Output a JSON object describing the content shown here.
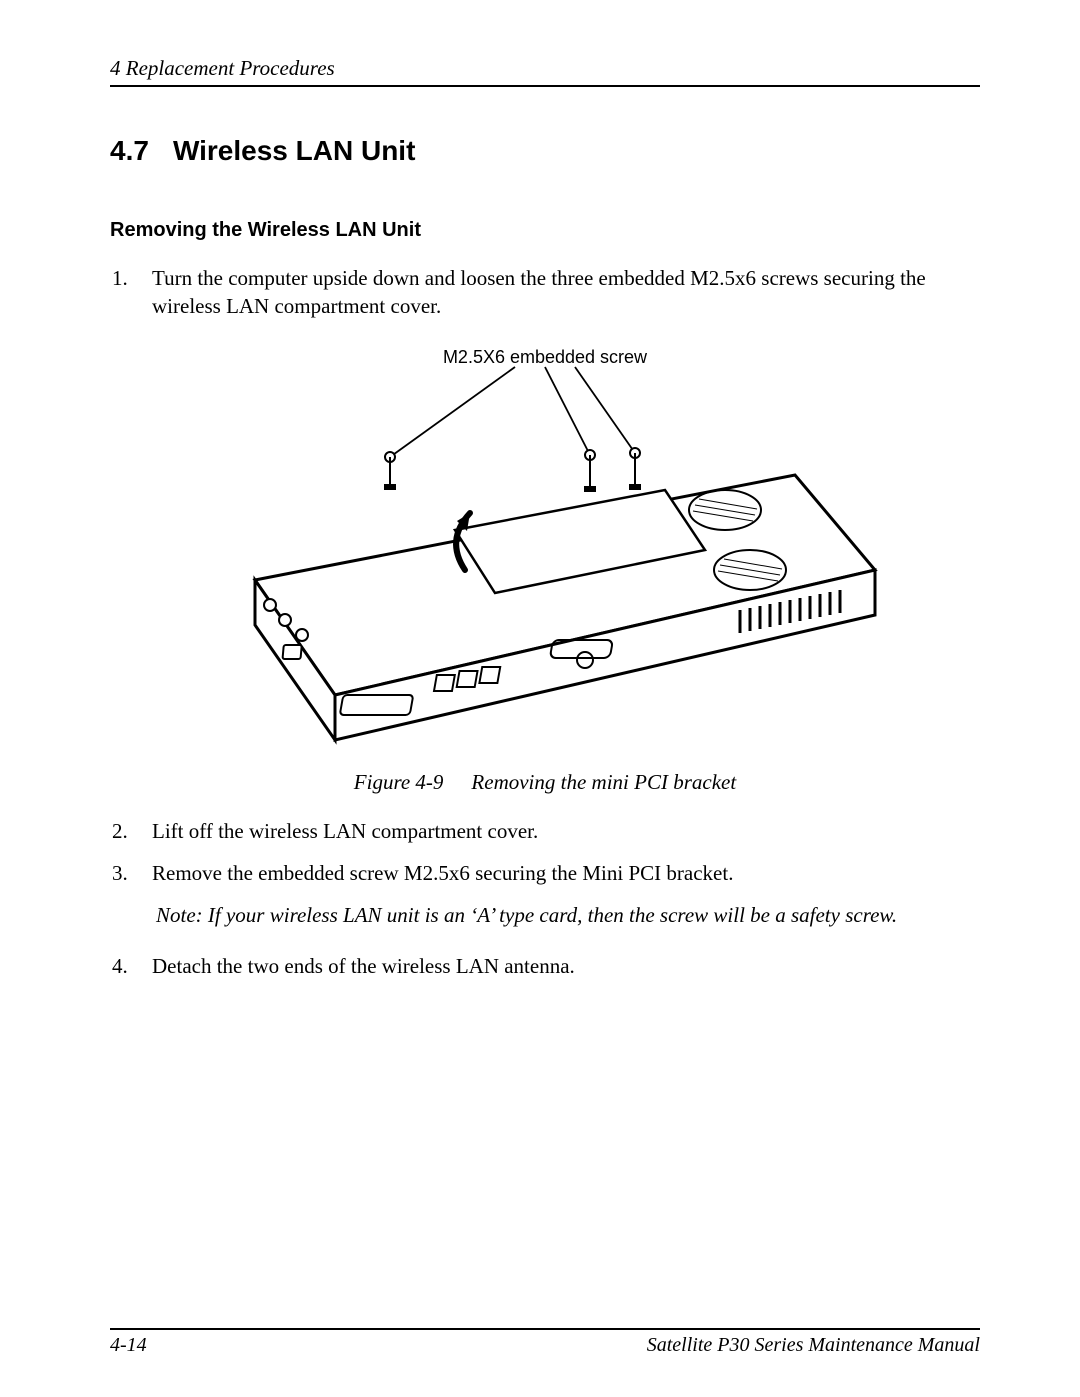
{
  "header": {
    "chapter_line": "4  Replacement Procedures"
  },
  "section": {
    "number": "4.7",
    "title": "Wireless LAN Unit"
  },
  "subsection": {
    "title": "Removing the Wireless LAN Unit"
  },
  "step_1": {
    "marker": "1.",
    "text": "Turn the computer upside down and loosen the three embedded M2.5x6 screws securing the wireless LAN compartment cover."
  },
  "figure": {
    "label_in_diagram": "M2.5X6 embedded screw",
    "caption_label": "Figure 4-9",
    "caption_text": "Removing the mini PCI bracket"
  },
  "step_2": {
    "marker": "2.",
    "text": "Lift off the wireless LAN compartment cover."
  },
  "step_3": {
    "marker": "3.",
    "text": "Remove the embedded screw M2.5x6 securing the Mini PCI bracket."
  },
  "note": {
    "text": "Note: If your wireless LAN unit is an ‘A’ type card, then the screw will be a safety screw."
  },
  "step_4": {
    "marker": "4.",
    "text": "Detach the two ends of the wireless LAN antenna."
  },
  "footer": {
    "page": "4-14",
    "manual": "Satellite P30 Series Maintenance Manual"
  }
}
